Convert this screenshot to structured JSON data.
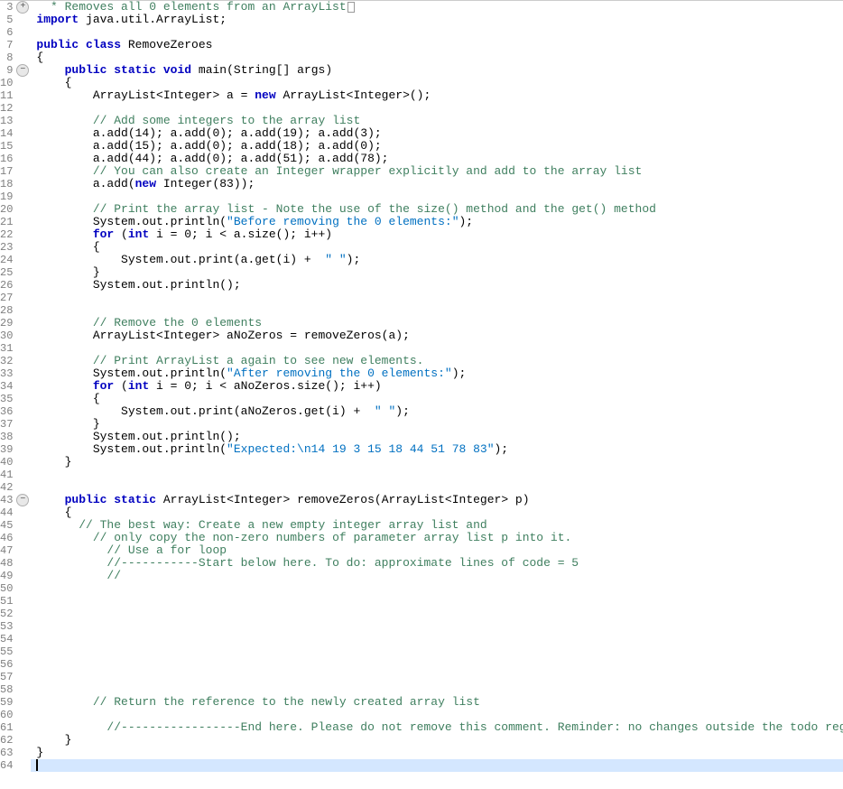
{
  "startLine": 3,
  "endLine": 64,
  "foldMarkers": {
    "3": "+",
    "9": "−",
    "43": "−"
  },
  "cursorLine": 64,
  "code": {
    "3": [
      {
        "t": "  * Removes all 0 elements from an ArrayList",
        "c": "comment"
      },
      {
        "t": "",
        "c": "eolbox"
      }
    ],
    "5": [
      {
        "t": "import",
        "c": "kw"
      },
      {
        "t": " java.util.ArrayList;",
        "c": ""
      }
    ],
    "6": [],
    "7": [
      {
        "t": "public",
        "c": "kw"
      },
      {
        "t": " ",
        "c": ""
      },
      {
        "t": "class",
        "c": "kw"
      },
      {
        "t": " RemoveZeroes",
        "c": ""
      }
    ],
    "8": [
      {
        "t": "{",
        "c": ""
      }
    ],
    "9": [
      {
        "t": "    ",
        "c": ""
      },
      {
        "t": "public",
        "c": "kw"
      },
      {
        "t": " ",
        "c": ""
      },
      {
        "t": "static",
        "c": "kw"
      },
      {
        "t": " ",
        "c": ""
      },
      {
        "t": "void",
        "c": "kw"
      },
      {
        "t": " main(String[] args)",
        "c": ""
      }
    ],
    "10": [
      {
        "t": "    {",
        "c": ""
      }
    ],
    "11": [
      {
        "t": "        ArrayList<Integer> a = ",
        "c": ""
      },
      {
        "t": "new",
        "c": "kw"
      },
      {
        "t": " ArrayList<Integer>();",
        "c": ""
      }
    ],
    "12": [],
    "13": [
      {
        "t": "        ",
        "c": ""
      },
      {
        "t": "// Add some integers to the array list",
        "c": "comment"
      }
    ],
    "14": [
      {
        "t": "        a.add(14); a.add(0); a.add(19); a.add(3);",
        "c": ""
      }
    ],
    "15": [
      {
        "t": "        a.add(15); a.add(0); a.add(18); a.add(0);",
        "c": ""
      }
    ],
    "16": [
      {
        "t": "        a.add(44); a.add(0); a.add(51); a.add(78);",
        "c": ""
      }
    ],
    "17": [
      {
        "t": "        ",
        "c": ""
      },
      {
        "t": "// You can also create an Integer wrapper explicitly and add to the array list",
        "c": "comment"
      }
    ],
    "18": [
      {
        "t": "        a.add(",
        "c": ""
      },
      {
        "t": "new",
        "c": "kw"
      },
      {
        "t": " Integer(83));",
        "c": ""
      }
    ],
    "19": [],
    "20": [
      {
        "t": "        ",
        "c": ""
      },
      {
        "t": "// Print the array list - Note the use of the size() method and the get() method",
        "c": "comment"
      }
    ],
    "21": [
      {
        "t": "        System.out.println(",
        "c": ""
      },
      {
        "t": "\"Before removing the 0 elements:\"",
        "c": "string"
      },
      {
        "t": ");",
        "c": ""
      }
    ],
    "22": [
      {
        "t": "        ",
        "c": ""
      },
      {
        "t": "for",
        "c": "kw"
      },
      {
        "t": " (",
        "c": ""
      },
      {
        "t": "int",
        "c": "kw"
      },
      {
        "t": " i = 0; i < a.size(); i++)",
        "c": ""
      }
    ],
    "23": [
      {
        "t": "        {",
        "c": ""
      }
    ],
    "24": [
      {
        "t": "            System.out.print(a.get(i) +  ",
        "c": ""
      },
      {
        "t": "\" \"",
        "c": "string"
      },
      {
        "t": ");",
        "c": ""
      }
    ],
    "25": [
      {
        "t": "        }",
        "c": ""
      }
    ],
    "26": [
      {
        "t": "        System.out.println();",
        "c": ""
      }
    ],
    "27": [],
    "28": [],
    "29": [
      {
        "t": "        ",
        "c": ""
      },
      {
        "t": "// Remove the 0 elements",
        "c": "comment"
      }
    ],
    "30": [
      {
        "t": "        ArrayList<Integer> aNoZeros = removeZeros(a);",
        "c": ""
      }
    ],
    "31": [],
    "32": [
      {
        "t": "        ",
        "c": ""
      },
      {
        "t": "// Print ArrayList a again to see new elements.",
        "c": "comment"
      }
    ],
    "33": [
      {
        "t": "        System.out.println(",
        "c": ""
      },
      {
        "t": "\"After removing the 0 elements:\"",
        "c": "string"
      },
      {
        "t": ");",
        "c": ""
      }
    ],
    "34": [
      {
        "t": "        ",
        "c": ""
      },
      {
        "t": "for",
        "c": "kw"
      },
      {
        "t": " (",
        "c": ""
      },
      {
        "t": "int",
        "c": "kw"
      },
      {
        "t": " i = 0; i < aNoZeros.size(); i++)",
        "c": ""
      }
    ],
    "35": [
      {
        "t": "        {",
        "c": ""
      }
    ],
    "36": [
      {
        "t": "            System.out.print(aNoZeros.get(i) +  ",
        "c": ""
      },
      {
        "t": "\" \"",
        "c": "string"
      },
      {
        "t": ");",
        "c": ""
      }
    ],
    "37": [
      {
        "t": "        }",
        "c": ""
      }
    ],
    "38": [
      {
        "t": "        System.out.println();",
        "c": ""
      }
    ],
    "39": [
      {
        "t": "        System.out.println(",
        "c": ""
      },
      {
        "t": "\"Expected:\\n14 19 3 15 18 44 51 78 83\"",
        "c": "string"
      },
      {
        "t": ");",
        "c": ""
      }
    ],
    "40": [
      {
        "t": "    }",
        "c": ""
      }
    ],
    "41": [],
    "42": [],
    "43": [
      {
        "t": "    ",
        "c": ""
      },
      {
        "t": "public",
        "c": "kw"
      },
      {
        "t": " ",
        "c": ""
      },
      {
        "t": "static",
        "c": "kw"
      },
      {
        "t": " ArrayList<Integer> removeZeros(ArrayList<Integer> p)",
        "c": ""
      }
    ],
    "44": [
      {
        "t": "    {",
        "c": ""
      }
    ],
    "45": [
      {
        "t": "      ",
        "c": ""
      },
      {
        "t": "// The best way: Create a new empty integer array list and",
        "c": "comment"
      }
    ],
    "46": [
      {
        "t": "        ",
        "c": ""
      },
      {
        "t": "// only copy the non-zero numbers of parameter array list p into it.",
        "c": "comment"
      }
    ],
    "47": [
      {
        "t": "          ",
        "c": ""
      },
      {
        "t": "// Use a for loop",
        "c": "comment"
      }
    ],
    "48": [
      {
        "t": "          ",
        "c": ""
      },
      {
        "t": "//-----------Start below here. To do: approximate lines of code = 5",
        "c": "comment"
      }
    ],
    "49": [
      {
        "t": "          ",
        "c": ""
      },
      {
        "t": "//",
        "c": "comment"
      }
    ],
    "50": [],
    "51": [],
    "52": [],
    "53": [],
    "54": [],
    "55": [],
    "56": [],
    "57": [],
    "58": [],
    "59": [
      {
        "t": "        ",
        "c": ""
      },
      {
        "t": "// Return the reference to the newly created array list",
        "c": "comment"
      }
    ],
    "60": [],
    "61": [
      {
        "t": "          ",
        "c": ""
      },
      {
        "t": "//-----------------End here. Please do not remove this comment. Reminder: no changes outside the todo regions.",
        "c": "comment"
      }
    ],
    "62": [
      {
        "t": "    }",
        "c": ""
      }
    ],
    "63": [
      {
        "t": "}",
        "c": ""
      }
    ],
    "64": [
      {
        "t": "",
        "c": "caret"
      }
    ]
  },
  "skipLines": [
    4
  ]
}
